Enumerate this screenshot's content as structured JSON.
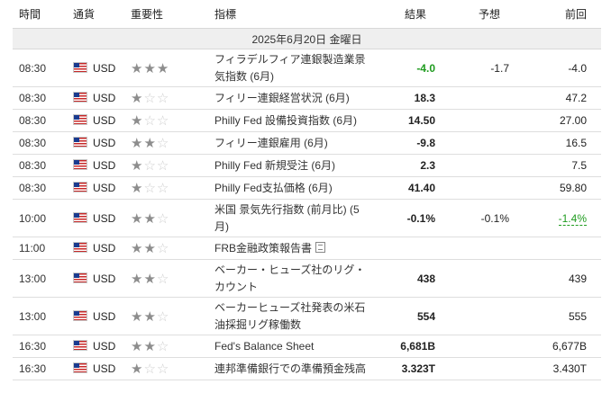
{
  "headers": {
    "time": "時間",
    "currency": "通貨",
    "importance": "重要性",
    "indicator": "指標",
    "actual": "結果",
    "forecast": "予想",
    "previous": "前回"
  },
  "date_label": "2025年6月20日 金曜日",
  "colors": {
    "positive": "#1e9b1e",
    "star_on": "#8d8d8d",
    "star_off": "#cfcfcf"
  },
  "rows": [
    {
      "time": "08:30",
      "currency": "USD",
      "importance": 3,
      "indicator": "フィラデルフィア連銀製造業景気指数 (6月)",
      "actual": "-4.0",
      "actual_color": "green",
      "forecast": "-1.7",
      "previous": "-4.0"
    },
    {
      "time": "08:30",
      "currency": "USD",
      "importance": 1,
      "indicator": "フィリー連銀経営状況 (6月)",
      "actual": "18.3",
      "forecast": "",
      "previous": "47.2"
    },
    {
      "time": "08:30",
      "currency": "USD",
      "importance": 1,
      "indicator": "Philly Fed 設備投資指数 (6月)",
      "actual": "14.50",
      "forecast": "",
      "previous": "27.00"
    },
    {
      "time": "08:30",
      "currency": "USD",
      "importance": 2,
      "indicator": "フィリー連銀雇用 (6月)",
      "actual": "-9.8",
      "forecast": "",
      "previous": "16.5"
    },
    {
      "time": "08:30",
      "currency": "USD",
      "importance": 1,
      "indicator": "Philly Fed 新規受注 (6月)",
      "actual": "2.3",
      "forecast": "",
      "previous": "7.5"
    },
    {
      "time": "08:30",
      "currency": "USD",
      "importance": 1,
      "indicator": "Philly Fed支払価格 (6月)",
      "actual": "41.40",
      "forecast": "",
      "previous": "59.80"
    },
    {
      "time": "10:00",
      "currency": "USD",
      "importance": 2,
      "indicator": "米国 景気先行指数 (前月比) (5月)",
      "actual": "-0.1%",
      "forecast": "-0.1%",
      "previous": "-1.4%",
      "previous_color": "green"
    },
    {
      "time": "11:00",
      "currency": "USD",
      "importance": 2,
      "indicator": "FRB金融政策報告書",
      "doc_icon": true,
      "actual": "",
      "forecast": "",
      "previous": ""
    },
    {
      "time": "13:00",
      "currency": "USD",
      "importance": 2,
      "indicator": "ベーカー・ヒューズ社のリグ・カウント",
      "actual": "438",
      "forecast": "",
      "previous": "439"
    },
    {
      "time": "13:00",
      "currency": "USD",
      "importance": 2,
      "indicator": "ベーカーヒューズ社発表の米石油採掘リグ稼働数",
      "actual": "554",
      "forecast": "",
      "previous": "555"
    },
    {
      "time": "16:30",
      "currency": "USD",
      "importance": 2,
      "indicator": "Fed's Balance Sheet",
      "actual": "6,681B",
      "forecast": "",
      "previous": "6,677B"
    },
    {
      "time": "16:30",
      "currency": "USD",
      "importance": 1,
      "indicator": "連邦準備銀行での準備預金残高",
      "actual": "3.323T",
      "forecast": "",
      "previous": "3.430T"
    }
  ]
}
